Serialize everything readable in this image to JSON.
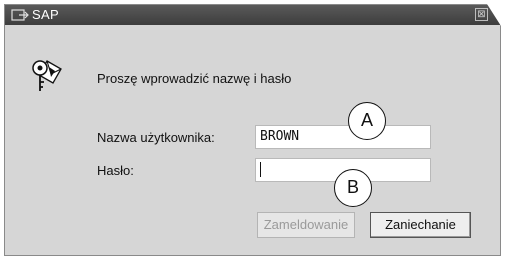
{
  "window": {
    "title": "SAP",
    "close_glyph": "⊠"
  },
  "dialog": {
    "prompt": "Proszę wprowadzić nazwę i hasło",
    "icon": "key-envelope-icon"
  },
  "form": {
    "username_label": "Nazwa użytkownika:",
    "username_value": "BROWN",
    "password_label": "Hasło:",
    "password_value": ""
  },
  "buttons": {
    "login_label": "Zameldowanie",
    "login_enabled": false,
    "cancel_label": "Zaniechanie"
  },
  "callouts": {
    "a": "A",
    "b": "B"
  },
  "colors": {
    "titlebar": "#4a4a4a",
    "window_bg": "#d6d6d6",
    "disabled_text": "#9a9a9a"
  }
}
